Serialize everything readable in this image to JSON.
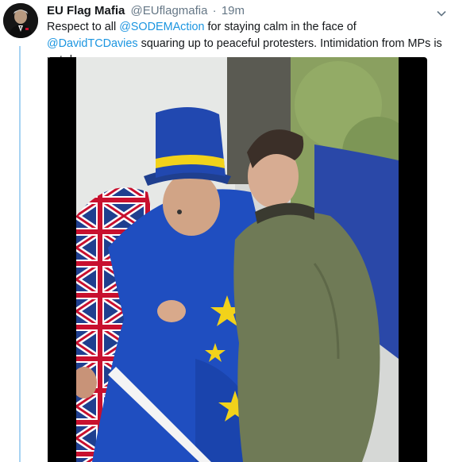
{
  "tweet": {
    "display_name": "EU Flag Mafia",
    "handle": "@EUflagmafia",
    "separator": "·",
    "timestamp": "19m",
    "text_parts": {
      "p1": "Respect to all ",
      "mention1": "@SODEMAction",
      "p2": " for staying calm in the face of ",
      "mention2": "@DavidTCDavies",
      "p3": " squaring up to peaceful protesters. Intimidation from MPs is not democracy."
    }
  },
  "icons": {
    "avatar": "avatar",
    "caret": "chevron-down-icon",
    "media": "video-thumbnail"
  },
  "colors": {
    "link": "#1b95e0",
    "secondary_text": "#657786",
    "thread_line": "#a7d3f3",
    "eu_blue": "#1f4ec0",
    "eu_star": "#f2d21a"
  }
}
